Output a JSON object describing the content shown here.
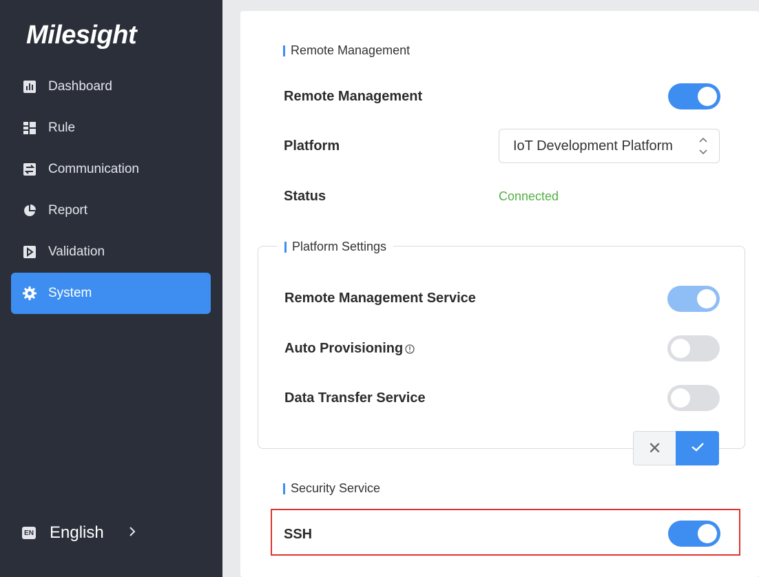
{
  "brand": {
    "logo_text": "Milesight"
  },
  "sidebar": {
    "items": [
      {
        "label": "Dashboard",
        "icon": "dashboard-icon"
      },
      {
        "label": "Rule",
        "icon": "rule-icon"
      },
      {
        "label": "Communication",
        "icon": "communication-icon"
      },
      {
        "label": "Report",
        "icon": "report-icon"
      },
      {
        "label": "Validation",
        "icon": "validation-icon"
      },
      {
        "label": "System",
        "icon": "gear-icon",
        "active": true
      }
    ],
    "language": {
      "badge": "EN",
      "label": "English"
    }
  },
  "remote_management": {
    "section_title": "Remote Management",
    "toggle_label": "Remote Management",
    "toggle_on": true,
    "platform_label": "Platform",
    "platform_value": "IoT Development Platform",
    "status_label": "Status",
    "status_value": "Connected"
  },
  "platform_settings": {
    "section_title": "Platform Settings",
    "rows": [
      {
        "label": "Remote Management Service",
        "state": "on-disabled"
      },
      {
        "label": "Auto Provisioning",
        "state": "off",
        "info_icon": true
      },
      {
        "label": "Data Transfer Service",
        "state": "off"
      }
    ],
    "cancel_glyph": "✕"
  },
  "security_service": {
    "section_title": "Security Service",
    "ssh_label": "SSH",
    "ssh_on": true
  },
  "colors": {
    "accent": "#3d8ef0",
    "sidebar_bg": "#2a2f3a",
    "status_ok": "#52b043",
    "highlight": "#e0322e"
  }
}
